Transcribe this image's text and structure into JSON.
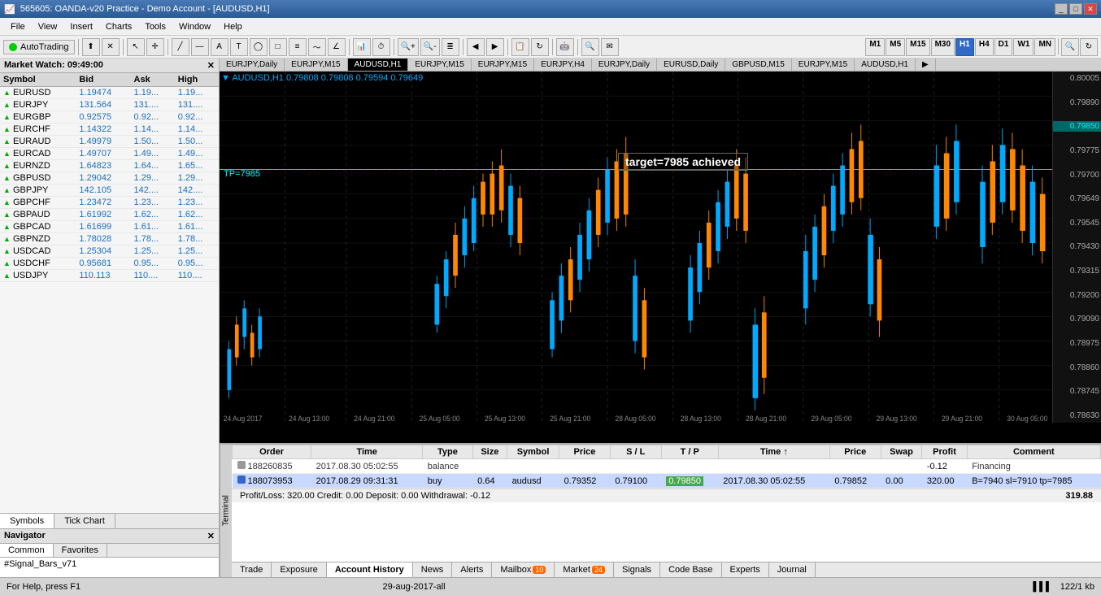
{
  "titleBar": {
    "title": "565605: OANDA-v20 Practice - Demo Account - [AUDUSD,H1]",
    "buttons": [
      "minimize",
      "restore",
      "close"
    ]
  },
  "menuBar": {
    "items": [
      "File",
      "View",
      "Insert",
      "Charts",
      "Tools",
      "Window",
      "Help"
    ]
  },
  "toolbar": {
    "autoTrading": "AutoTrading",
    "timeframes": [
      "M1",
      "M5",
      "M15",
      "M30",
      "H1",
      "H4",
      "D1",
      "W1",
      "MN"
    ],
    "activeTimeframe": "H1"
  },
  "marketWatch": {
    "title": "Market Watch: 09:49:00",
    "columns": [
      "Symbol",
      "Bid",
      "Ask",
      "High"
    ],
    "rows": [
      {
        "symbol": "EURUSD",
        "bid": "1.19474",
        "ask": "1.19...",
        "high": "1.19..."
      },
      {
        "symbol": "EURJPY",
        "bid": "131.564",
        "ask": "131....",
        "high": "131...."
      },
      {
        "symbol": "EURGBP",
        "bid": "0.92575",
        "ask": "0.92...",
        "high": "0.92..."
      },
      {
        "symbol": "EURCHF",
        "bid": "1.14322",
        "ask": "1.14...",
        "high": "1.14..."
      },
      {
        "symbol": "EURAUD",
        "bid": "1.49979",
        "ask": "1.50...",
        "high": "1.50..."
      },
      {
        "symbol": "EURCAD",
        "bid": "1.49707",
        "ask": "1.49...",
        "high": "1.49..."
      },
      {
        "symbol": "EURNZD",
        "bid": "1.64823",
        "ask": "1.64...",
        "high": "1.65..."
      },
      {
        "symbol": "GBPUSD",
        "bid": "1.29042",
        "ask": "1.29...",
        "high": "1.29..."
      },
      {
        "symbol": "GBPJPY",
        "bid": "142.105",
        "ask": "142....",
        "high": "142...."
      },
      {
        "symbol": "GBPCHF",
        "bid": "1.23472",
        "ask": "1.23...",
        "high": "1.23..."
      },
      {
        "symbol": "GBPAUD",
        "bid": "1.61992",
        "ask": "1.62...",
        "high": "1.62..."
      },
      {
        "symbol": "GBPCAD",
        "bid": "1.61699",
        "ask": "1.61...",
        "high": "1.61..."
      },
      {
        "symbol": "GBPNZD",
        "bid": "1.78028",
        "ask": "1.78...",
        "high": "1.78..."
      },
      {
        "symbol": "USDCAD",
        "bid": "1.25304",
        "ask": "1.25...",
        "high": "1.25..."
      },
      {
        "symbol": "USDCHF",
        "bid": "0.95681",
        "ask": "0.95...",
        "high": "0.95..."
      },
      {
        "symbol": "USDJPY",
        "bid": "110.113",
        "ask": "110....",
        "high": "110...."
      }
    ],
    "tabs": [
      "Symbols",
      "Tick Chart"
    ]
  },
  "navigator": {
    "title": "Navigator",
    "tabs": [
      "Common",
      "Favorites"
    ],
    "activeTab": "Common",
    "content": "#Signal_Bars_v71"
  },
  "chart": {
    "symbol": "AUDUSD,H1",
    "ohlc": "0.79808 0.79808 0.79594 0.79649",
    "targetLabel": "target=7985 achieved",
    "tpLabel": "TP=7985",
    "priceHigh": "0.80005",
    "prices": [
      "0.79890",
      "0.79850",
      "0.79775",
      "0.79700",
      "0.79649",
      "0.79545",
      "0.79430",
      "0.79315",
      "0.79200",
      "0.79090",
      "0.78975",
      "0.78860",
      "0.78745",
      "0.78630"
    ],
    "highlightedPrice": "0.79850",
    "tabs": [
      "EURJPY,Daily",
      "EURJPY,M15",
      "AUDUSD,H1",
      "EURJPY,M15",
      "EURJPY,M15",
      "EURJPY,H4",
      "EURJPY,Daily",
      "EURUSD,Daily",
      "GBPUSD,M15",
      "EURJPY,M15",
      "AUDUSD,H1"
    ],
    "activeTab": "AUDUSD,H1",
    "xLabels": [
      "24 Aug 2017",
      "24 Aug 13:00",
      "24 Aug 21:00",
      "25 Aug 05:00",
      "25 Aug 13:00",
      "25 Aug 21:00",
      "28 Aug 05:00",
      "28 Aug 13:00",
      "28 Aug 21:00",
      "29 Aug 05:00",
      "29 Aug 13:00",
      "29 Aug 21:00",
      "30 Aug 05:00"
    ]
  },
  "terminal": {
    "tabs": [
      "Trade",
      "Exposure",
      "Account History",
      "News",
      "Alerts",
      "Mailbox",
      "Market",
      "Signals",
      "Code Base",
      "Experts",
      "Journal"
    ],
    "activeTab": "Account History",
    "mailboxCount": "10",
    "marketCount": "24",
    "tableHeaders": [
      "Order",
      "Time",
      "Type",
      "Size",
      "Symbol",
      "Price",
      "S / L",
      "T / P",
      "Time",
      "Price",
      "Swap",
      "Profit",
      "Comment"
    ],
    "rows": [
      {
        "order": "188260835",
        "time": "2017.08.30 05:02:55",
        "type": "balance",
        "size": "",
        "symbol": "",
        "price": "",
        "sl": "",
        "tp": "",
        "time2": "",
        "price2": "",
        "swap": "",
        "profit": "-0.12",
        "comment": "Financing"
      },
      {
        "order": "188073953",
        "time": "2017.08.29 09:31:31",
        "type": "buy",
        "size": "0.64",
        "symbol": "audusd",
        "price": "0.79352",
        "sl": "0.79100",
        "tp": "0.79850",
        "time2": "2017.08.30 05:02:55",
        "price2": "0.79852",
        "swap": "0.00",
        "profit": "320.00",
        "comment": "B=7940 sl=7910 tp=7985"
      }
    ],
    "summary": "Profit/Loss: 320.00  Credit: 0.00  Deposit: 0.00  Withdrawal: -0.12",
    "totalProfit": "319.88"
  },
  "statusBar": {
    "help": "For Help, press F1",
    "date": "29-aug-2017-all",
    "memory": "122/1 kb"
  }
}
